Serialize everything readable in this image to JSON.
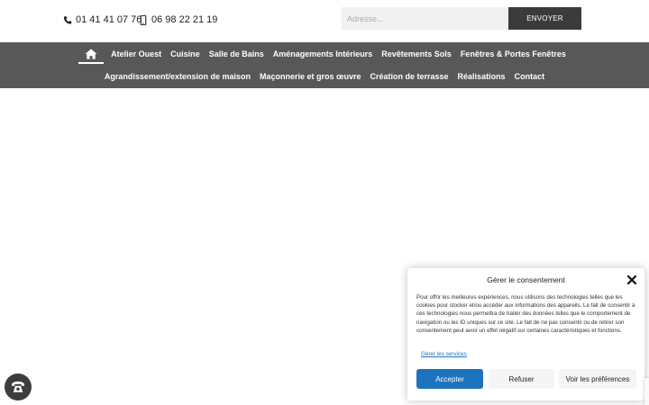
{
  "header": {
    "phone_landline": "01 41 41 07 76",
    "phone_mobile": "06 98 22 21 19",
    "search_placeholder": "Adresse...",
    "send_label": "ENVOYER"
  },
  "nav": {
    "row1": [
      "Atelier Ouest",
      "Cuisine",
      "Salle de Bains",
      "Aménagements Intérieurs",
      "Revêtements Sols",
      "Fenêtres & Portes Fenêtres"
    ],
    "row2": [
      "Agrandissement/extension de maison",
      "Maçonnerie et gros œuvre",
      "Création de terrasse",
      "Réalisations",
      "Contact"
    ]
  },
  "cookie": {
    "title": "Gérer le consentement",
    "text": "Pour offrir les meilleures expériences, nous utilisons des technologies telles que les cookies pour stocker et/ou accéder aux informations des appareils. Le fait de consentir à ces technologies nous permettra de traiter des données telles que le comportement de navigation ou les ID uniques sur ce site. Le fait de ne pas consentir ou de retirer son consentement peut avoir un effet négatif sur certaines caractéristiques et fonctions.",
    "manage_link": "Gérer les services",
    "accept_label": "Accepter",
    "refuse_label": "Refuser",
    "prefs_label": "Voir les préférences"
  },
  "colors": {
    "nav_bg": "#585858",
    "send_bg": "#3b3b3b",
    "accept_bg": "#1e73be"
  }
}
